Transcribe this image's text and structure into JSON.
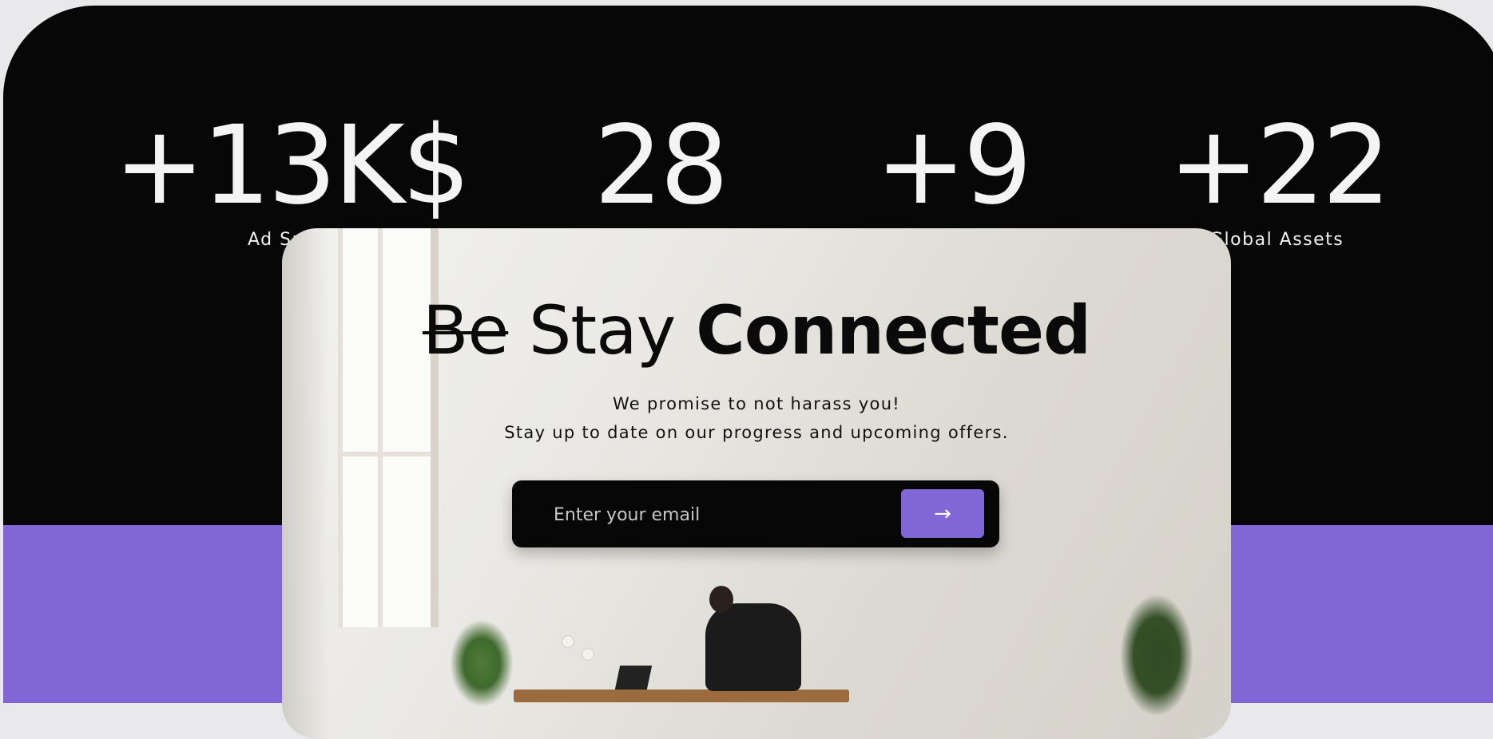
{
  "stats": [
    {
      "value": "+13K$",
      "label": "Ad Sp"
    },
    {
      "value": "28",
      "label": ""
    },
    {
      "value": "+9",
      "label": ""
    },
    {
      "value": "+22",
      "label": "Global Assets"
    }
  ],
  "newsletter": {
    "headline_strike": "Be",
    "headline_thin": "Stay",
    "headline_bold": "Connected",
    "line1": "We promise to not harass you!",
    "line2": "Stay up to date on our progress and upcoming offers.",
    "email_placeholder": "Enter your email",
    "submit_label": "→",
    "submit_icon": "arrow-right-icon"
  },
  "colors": {
    "dark": "#070707",
    "accent": "#8167d6",
    "text_light": "#f4f4f4"
  }
}
